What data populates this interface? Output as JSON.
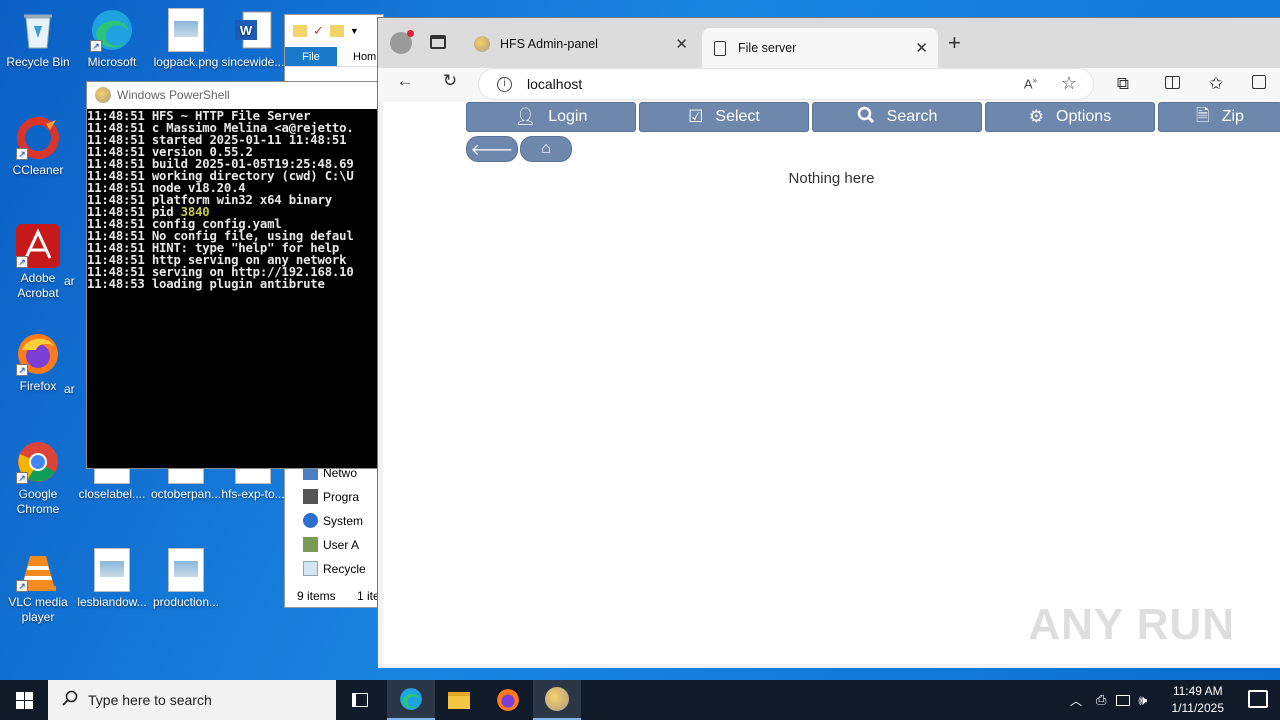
{
  "desktop": {
    "icons": [
      {
        "label": "Recycle Bin"
      },
      {
        "label": "Microsoft Edge"
      },
      {
        "label": "logpack.png"
      },
      {
        "label": "sincewide..."
      },
      {
        "label": "CCleaner"
      },
      {
        "label": "Adobe Acrobat"
      },
      {
        "label": "Firefox"
      },
      {
        "label": "Google Chrome"
      },
      {
        "label": "closelabel...."
      },
      {
        "label": "octoberpan..."
      },
      {
        "label": "hfs-exp-to..."
      },
      {
        "label": "VLC media player"
      },
      {
        "label": "lesbiandow..."
      },
      {
        "label": "production..."
      },
      {
        "label": "ar"
      },
      {
        "label": "ar"
      }
    ]
  },
  "explorer": {
    "tab_file": "File",
    "tab_home": "Hom",
    "tree": [
      "Netwo",
      "Progra",
      "System",
      "User A",
      "Recycle"
    ],
    "status_items": "9 items",
    "status_selected": "1 ite"
  },
  "powershell": {
    "title": "Windows PowerShell",
    "lines": [
      "11:48:51 HFS ~ HTTP File Server",
      "11:48:51 c Massimo Melina <a@rejetto.",
      "11:48:51 started 2025-01-11 11:48:51",
      "11:48:51 version 0.55.2",
      "11:48:51 build 2025-01-05T19:25:48.69",
      "11:48:51 working directory (cwd) C:\\U",
      "11:48:51 node v18.20.4",
      "11:48:51 platform win32 x64 binary",
      "11:48:51 pid ",
      "11:48:51 config config.yaml",
      "11:48:51 No config file, using defaul",
      "11:48:51 HINT: type \"help\" for help",
      "11:48:51 http serving on any network",
      "11:48:51 serving on http://192.168.10",
      "11:48:53 loading plugin antibrute"
    ],
    "pid": "3840"
  },
  "browser": {
    "tabs": [
      {
        "title": "HFS Admin-panel",
        "close": "✕"
      },
      {
        "title": "File server",
        "close": "✕"
      }
    ],
    "new_tab": "+",
    "url": "localhost",
    "hfs": {
      "buttons": [
        {
          "label": "Login",
          "icon": "user-icon"
        },
        {
          "label": "Select",
          "icon": "checkbox-icon"
        },
        {
          "label": "Search",
          "icon": "search-icon"
        },
        {
          "label": "Options",
          "icon": "gear-icon"
        },
        {
          "label": "Zip",
          "icon": "zip-file-icon"
        }
      ],
      "empty_message": "Nothing here"
    },
    "watermark": "ANY RUN"
  },
  "taskbar": {
    "search_placeholder": "Type here to search",
    "time": "11:49 AM",
    "date": "1/11/2025"
  },
  "colors": {
    "hfs_button": "#6e88ad",
    "desktop": "#0a6fd0",
    "taskbar": "#101a29"
  }
}
